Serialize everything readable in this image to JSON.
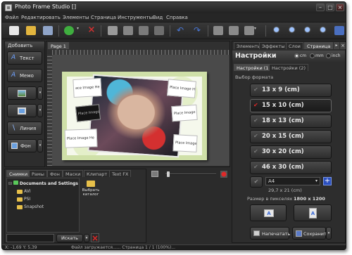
{
  "window": {
    "title": "Photo Frame Studio []"
  },
  "menu": [
    "Файл",
    "Редактировать",
    "Элементы",
    "Страница",
    "Инструменты",
    "Вид",
    "Справка"
  ],
  "left_panel": {
    "header": "Добавить",
    "buttons": [
      {
        "label": "Текст",
        "icon": "text-icon"
      },
      {
        "label": "Мемо",
        "icon": "memo-icon"
      },
      {
        "label": "",
        "icon": "image-icon"
      },
      {
        "label": "",
        "icon": "frame-icon"
      },
      {
        "label": "Линия",
        "icon": "line-icon"
      },
      {
        "label": "Фон",
        "icon": "background-icon"
      }
    ]
  },
  "canvas": {
    "tab": "Page 1",
    "placeholders": [
      "ace Image He",
      "Place Image He",
      "Place Image Here",
      "Place Image Her",
      "Place Image Here",
      "Place Image Here"
    ]
  },
  "bottom_panel": {
    "tabs": [
      "Снимки",
      "Рамы",
      "Фон",
      "Маски",
      "Клипарт",
      "Text FX"
    ],
    "tree": {
      "root": "Documents and Settings",
      "children": [
        "AVI",
        "PSI",
        "Snapshot"
      ]
    },
    "choose_catalog": "Выбрать каталог",
    "search_button": "Искать",
    "search_value": ""
  },
  "right_panel": {
    "top_tabs": [
      "Элементы",
      "Эффекты",
      "Слои",
      "Страница"
    ],
    "title": "Настройки",
    "units": [
      {
        "label": "cm",
        "selected": true
      },
      {
        "label": "mm",
        "selected": false
      },
      {
        "label": "inch",
        "selected": false
      }
    ],
    "settings_tabs": [
      "Настройки (1)",
      "Настройки (2)"
    ],
    "format_label": "Выбор формата",
    "formats": [
      {
        "label": "13 x 9 (cm)",
        "selected": false
      },
      {
        "label": "15 x 10 (cm)",
        "selected": true
      },
      {
        "label": "18 x 13 (cm)",
        "selected": false
      },
      {
        "label": "20 x 15 (cm)",
        "selected": false
      },
      {
        "label": "30 x 20 (cm)",
        "selected": false
      },
      {
        "label": "46 x 30 (cm)",
        "selected": false
      }
    ],
    "paper_select": "A4",
    "paper_size": "29,7 x 21 (cm)",
    "pixel_size_label": "Размер в пикселях",
    "pixel_size_value": "1800 x 1200",
    "print_button": "Напечатать",
    "save_button": "Сохранить"
  },
  "status_bar": {
    "coords": "X: -1,69 Y: 5,39",
    "message": "Файл загружается...... Страница 1 / 1 (100%)..."
  },
  "colors": {
    "accent_red": "#e02828",
    "frame_green": "#cfe0a8"
  }
}
